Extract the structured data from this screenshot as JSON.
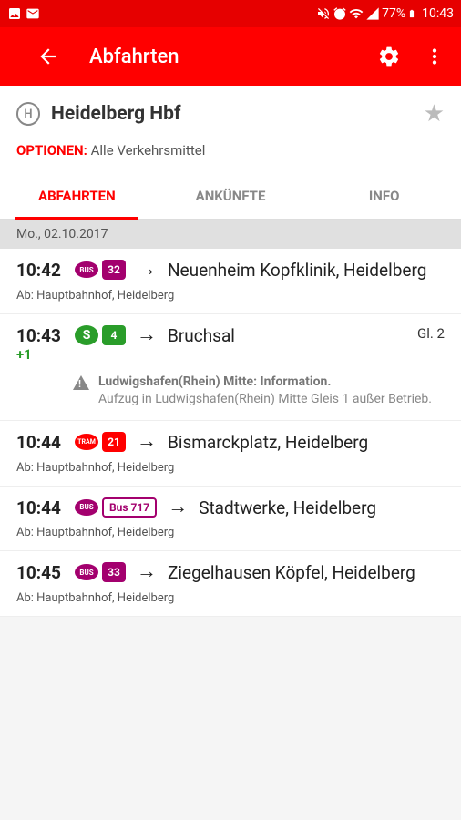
{
  "status": {
    "battery": "77%",
    "time": "10:43"
  },
  "appbar": {
    "title": "Abfahrten"
  },
  "station": {
    "icon_letter": "H",
    "name": "Heidelberg Hbf"
  },
  "options": {
    "label": "OPTIONEN:",
    "value": "Alle Verkehrsmittel"
  },
  "tabs": [
    {
      "label": "ABFAHRTEN",
      "active": true
    },
    {
      "label": "ANKÜNFTE",
      "active": false
    },
    {
      "label": "INFO",
      "active": false
    }
  ],
  "date": "Mo., 02.10.2017",
  "departures": [
    {
      "time": "10:42",
      "delay": "",
      "mode": "BUS",
      "mode_class": "bus",
      "line": "32",
      "line_class": "bus-line",
      "destination": "Neuenheim Kopfklinik, Heidelberg",
      "from": "Ab: Hauptbahnhof, Heidelberg",
      "platform": ""
    },
    {
      "time": "10:43",
      "delay": "+1",
      "mode": "S",
      "mode_class": "s",
      "line": "4",
      "line_class": "s-line",
      "destination": "Bruchsal",
      "from": "",
      "platform": "Gl. 2",
      "info_title": "Ludwigshafen(Rhein) Mitte: Information.",
      "info_text": "Aufzug in Ludwigshafen(Rhein) Mitte Gleis 1 außer Betrieb."
    },
    {
      "time": "10:44",
      "delay": "",
      "mode": "TRAM",
      "mode_class": "tram",
      "line": "21",
      "line_class": "tram-line",
      "destination": "Bismarckplatz, Heidelberg",
      "from": "Ab: Hauptbahnhof, Heidelberg",
      "platform": ""
    },
    {
      "time": "10:44",
      "delay": "",
      "mode": "BUS",
      "mode_class": "bus",
      "line": "Bus 717",
      "line_class": "bus-line-outline",
      "destination": "Stadtwerke, Heidelberg",
      "from": "Ab: Hauptbahnhof, Heidelberg",
      "platform": ""
    },
    {
      "time": "10:45",
      "delay": "",
      "mode": "BUS",
      "mode_class": "bus",
      "line": "33",
      "line_class": "bus-line",
      "destination": "Ziegelhausen Köpfel, Heidelberg",
      "from": "Ab: Hauptbahnhof, Heidelberg",
      "platform": ""
    }
  ]
}
